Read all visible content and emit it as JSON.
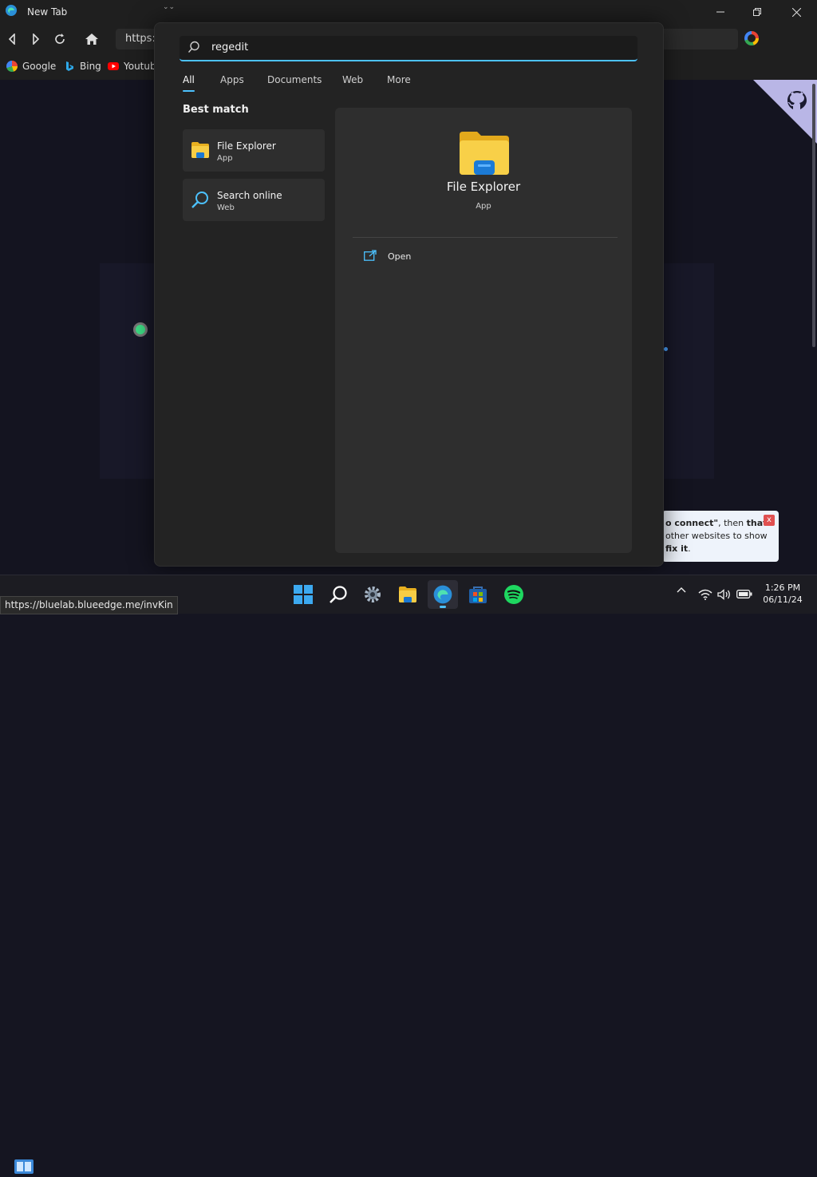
{
  "browser": {
    "tab_title": "New Tab",
    "address_text": "https:/",
    "bookmarks": [
      {
        "label": "Google",
        "icon": "google-icon"
      },
      {
        "label": "Bing",
        "icon": "bing-icon"
      },
      {
        "label": "Youtub",
        "icon": "youtube-icon"
      }
    ],
    "status_url": "https://bluelab.blueedge.me/invKin"
  },
  "search": {
    "query": "regedit",
    "filters": [
      "All",
      "Apps",
      "Documents",
      "Web",
      "More"
    ],
    "active_filter": "All",
    "best_match_heading": "Best match",
    "results": [
      {
        "title": "File Explorer",
        "subtitle": "App",
        "icon": "folder-icon"
      },
      {
        "title": "Search online",
        "subtitle": "Web",
        "icon": "search-icon"
      }
    ],
    "preview": {
      "title": "File Explorer",
      "subtitle": "App",
      "actions": [
        {
          "label": "Open",
          "icon": "open-icon"
        }
      ]
    }
  },
  "toast": {
    "line1_bold": "o connect\"",
    "line1_rest": ", then ",
    "line1_bold2": "that",
    "line2": "other websites to show",
    "line3_bold": "fix it",
    "line3_rest": ".",
    "close": "x"
  },
  "taskbar": {
    "apps": [
      "start-icon",
      "search-icon",
      "settings-icon",
      "file-explorer-icon",
      "edge-icon",
      "store-icon",
      "spotify-icon"
    ],
    "active_app": "edge-icon",
    "time": "1:26 PM",
    "date": "06/11/24"
  },
  "colors": {
    "accent": "#4cc2ff",
    "panel": "#232323",
    "card": "#2e2e2e",
    "folder_yellow": "#f5c518",
    "spotify_green": "#1ed760"
  }
}
